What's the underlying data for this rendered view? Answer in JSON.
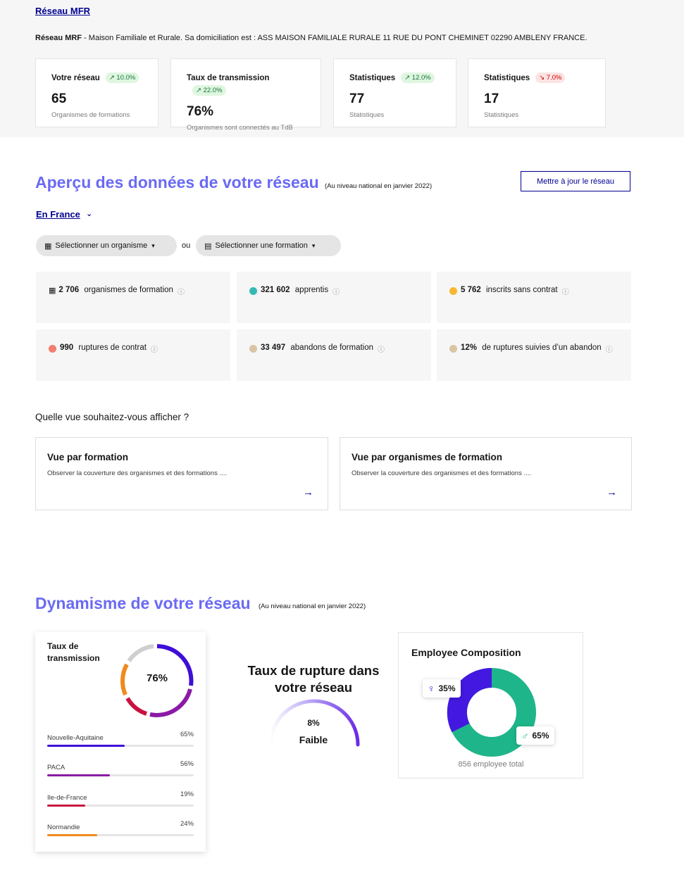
{
  "header": {
    "network_link": "Réseau MFR",
    "desc_bold": "Réseau MRF",
    "desc_rest": " - Maison Familiale et Rurale. Sa domiciliation est : ASS MAISON FAMILIALE RURALE 11 RUE DU PONT CHEMINET 02290 AMBLENY FRANCE."
  },
  "kpis": [
    {
      "title": "Votre réseau",
      "badge": "↗ 10.0%",
      "trend": "up",
      "value": "65",
      "sub": "Organismes de formations"
    },
    {
      "title": "Taux de transmission",
      "badge": "↗ 22.0%",
      "trend": "up",
      "value": "76%",
      "sub": "Organismes sont connectés au TdB"
    },
    {
      "title": "Statistiques",
      "badge": "↗ 12.0%",
      "trend": "up",
      "value": "77",
      "sub": "Statistiques"
    },
    {
      "title": "Statistiques",
      "badge": "↘ 7.0%",
      "trend": "down",
      "value": "17",
      "sub": "Statistiques"
    }
  ],
  "overview": {
    "title": "Aperçu des données de votre réseau",
    "note": "(Au niveau national en janvier 2022)",
    "update_button": "Mettre à jour le réseau",
    "scope": "En France",
    "select_org": "Sélectionner un organisme",
    "or": "ou",
    "select_formation": "Sélectionner une formation"
  },
  "stats": [
    {
      "icon": "building-icon",
      "value": "2 706",
      "label": " organismes de formation",
      "color": ""
    },
    {
      "icon": "dot",
      "value": "321 602",
      "label": " apprentis",
      "color": "#34bab5"
    },
    {
      "icon": "dot",
      "value": "5 762",
      "label": " inscrits sans contrat",
      "color": "#f7b731"
    },
    {
      "icon": "dot",
      "value": "990",
      "label": " ruptures de contrat",
      "color": "#f37d6f"
    },
    {
      "icon": "dot",
      "value": "33 497",
      "label": " abandons de formation",
      "color": "#d9c4a4"
    },
    {
      "icon": "dot",
      "value": "12%",
      "label": " de ruptures suivies d’un abandon",
      "color": "#d9c4a4"
    }
  ],
  "views": {
    "question": "Quelle vue souhaitez-vous afficher ?",
    "cards": [
      {
        "title": "Vue par formation",
        "desc": "Observer la couverture des organismes et des formations ...."
      },
      {
        "title": "Vue par organismes de formation",
        "desc": "Observer la couverture des organismes et des formations ...."
      }
    ]
  },
  "dynamism": {
    "title": "Dynamisme de votre réseau",
    "note": "(Au niveau national en janvier 2022)"
  },
  "transmission_card": {
    "title": "Taux de transmission",
    "center": "76%",
    "regions": [
      {
        "name": "Nouvelle-Aquitaine",
        "pct": "65%",
        "value": 0.53,
        "color": "#3f0fd8"
      },
      {
        "name": "PACA",
        "pct": "56%",
        "value": 0.43,
        "color": "#8b1aa6"
      },
      {
        "name": "Ile-de-France",
        "pct": "19%",
        "value": 0.26,
        "color": "#c8133f"
      },
      {
        "name": "Normandie",
        "pct": "24%",
        "value": 0.34,
        "color": "#f08a1e"
      }
    ]
  },
  "rupture": {
    "title": "Taux de rupture dans votre réseau",
    "pct": "8%",
    "level": "Faible"
  },
  "employee": {
    "title": "Employee Composition",
    "female_pct": "35%",
    "male_pct": "65%",
    "total": "856 employee total",
    "female_color": "#4318e0",
    "male_color": "#1fb58a"
  }
}
